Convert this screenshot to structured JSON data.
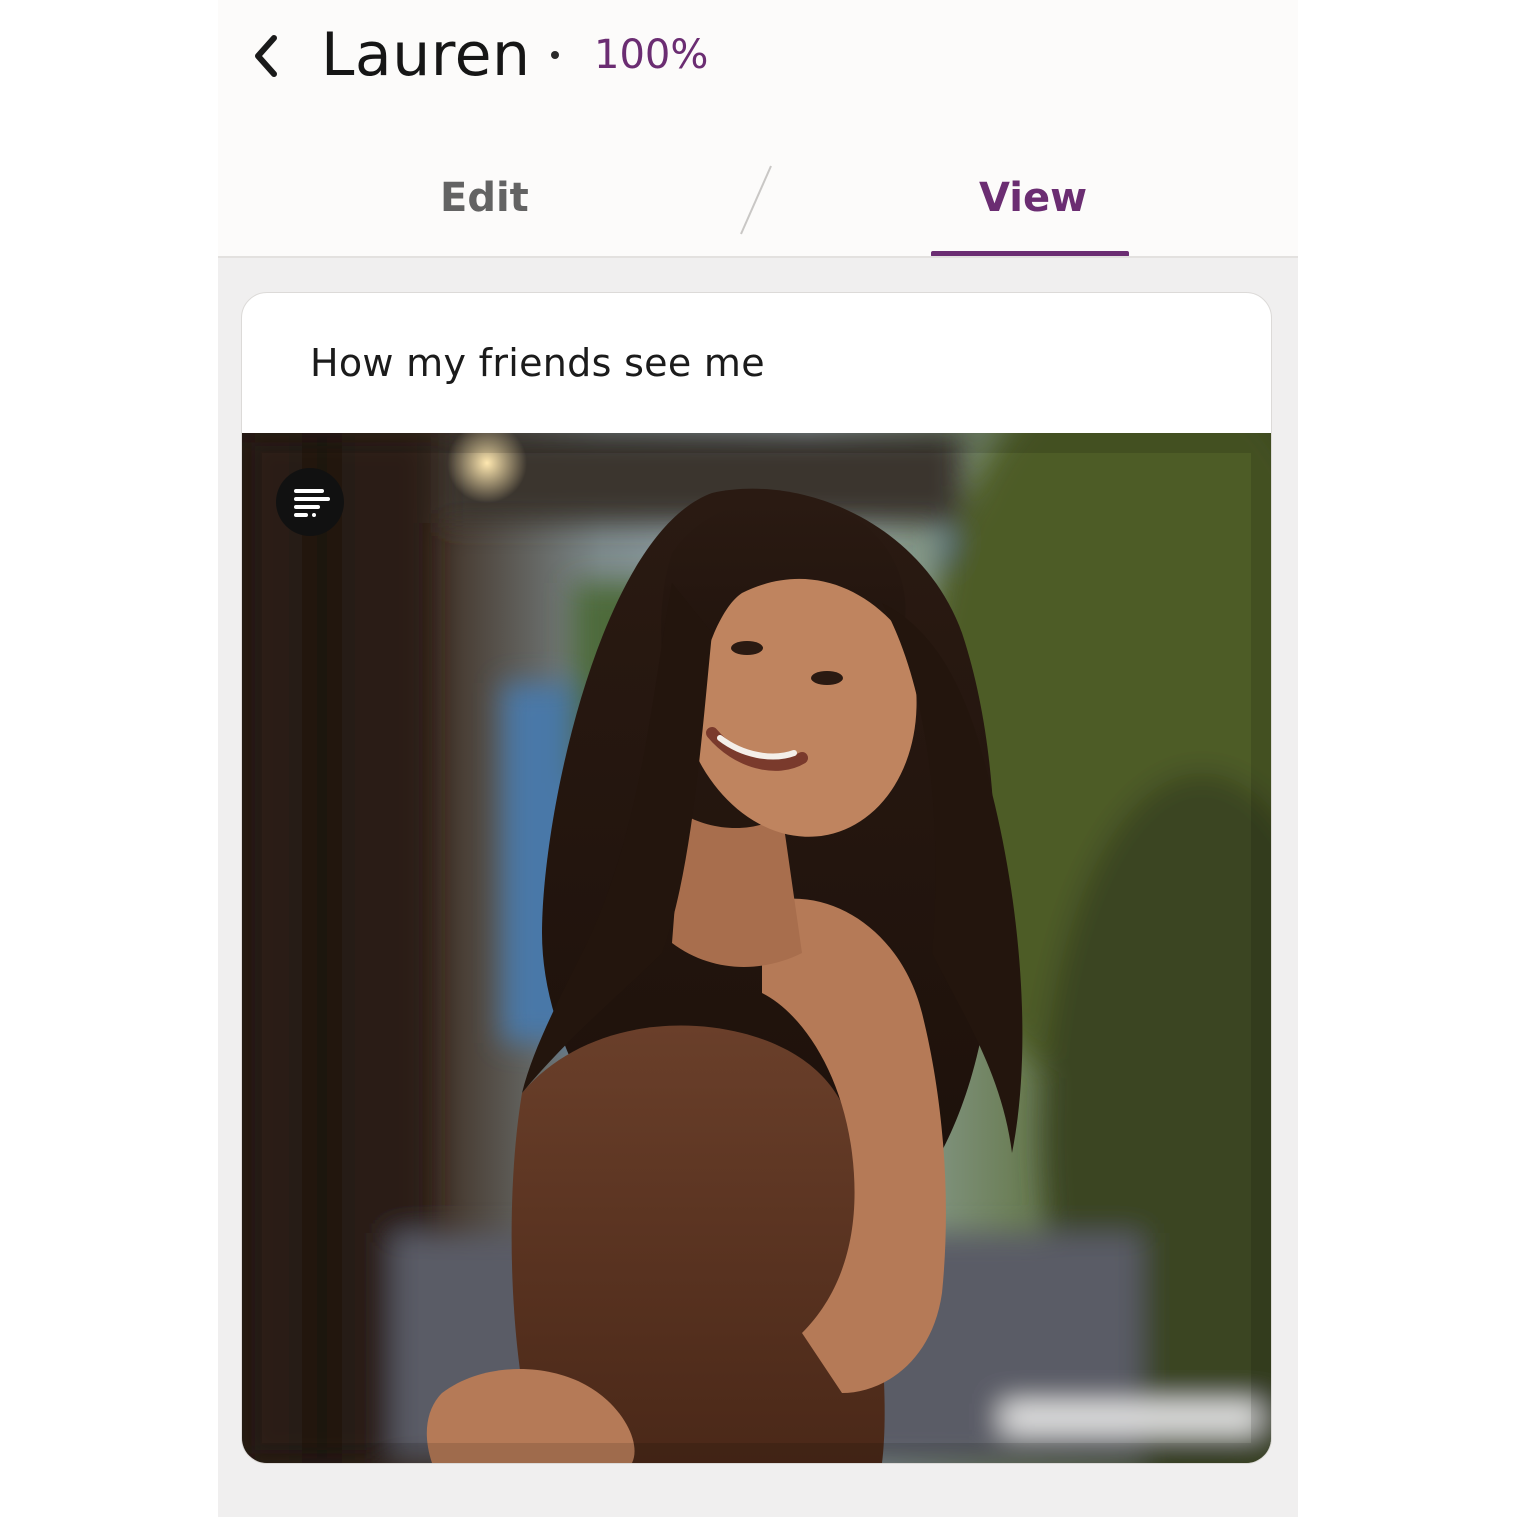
{
  "header": {
    "back_icon": "chevron-left-icon",
    "name": "Lauren",
    "separator": "·",
    "completion": "100%",
    "accent_color": "#6b2d72"
  },
  "tabs": [
    {
      "label": "Edit",
      "active": false
    },
    {
      "label": "View",
      "active": true
    }
  ],
  "card": {
    "prompt_title": "How my friends see me",
    "badge_icon": "prompt-lines-icon",
    "photo": {
      "description_icon": "profile-photo",
      "subject": "woman-in-brown-dress"
    }
  }
}
